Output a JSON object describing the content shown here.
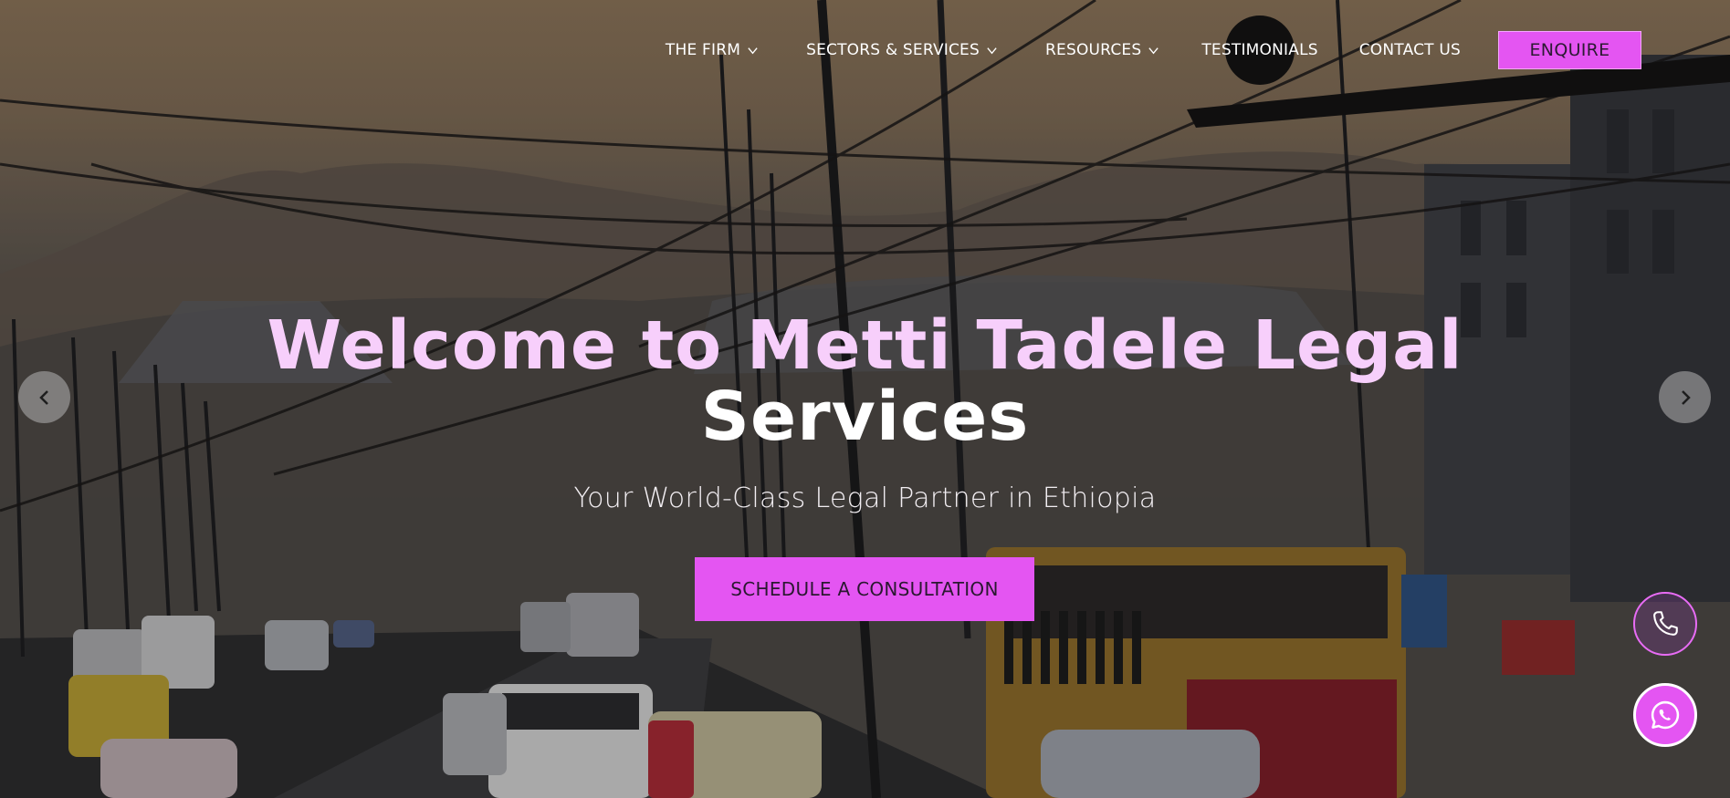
{
  "nav": {
    "items": [
      {
        "label": "THE FIRM",
        "has_dropdown": true
      },
      {
        "label": "SECTORS & SERVICES",
        "has_dropdown": true
      },
      {
        "label": "RESOURCES",
        "has_dropdown": true
      },
      {
        "label": "TESTIMONIALS",
        "has_dropdown": false
      },
      {
        "label": "CONTACT US",
        "has_dropdown": false
      }
    ],
    "enquire_label": "ENQUIRE"
  },
  "hero": {
    "title_line1": "Welcome to Metti Tadele Legal",
    "title_line2": "Services",
    "subtitle": "Your World-Class Legal Partner in Ethiopia",
    "cta_label": "SCHEDULE A CONSULTATION"
  },
  "carousel": {
    "prev_icon": "chevron-left-icon",
    "next_icon": "chevron-right-icon"
  },
  "floating": {
    "phone_icon": "phone-icon",
    "whatsapp_icon": "whatsapp-icon"
  },
  "colors": {
    "accent": "#e455f2",
    "title_pink": "#f7cffb"
  }
}
